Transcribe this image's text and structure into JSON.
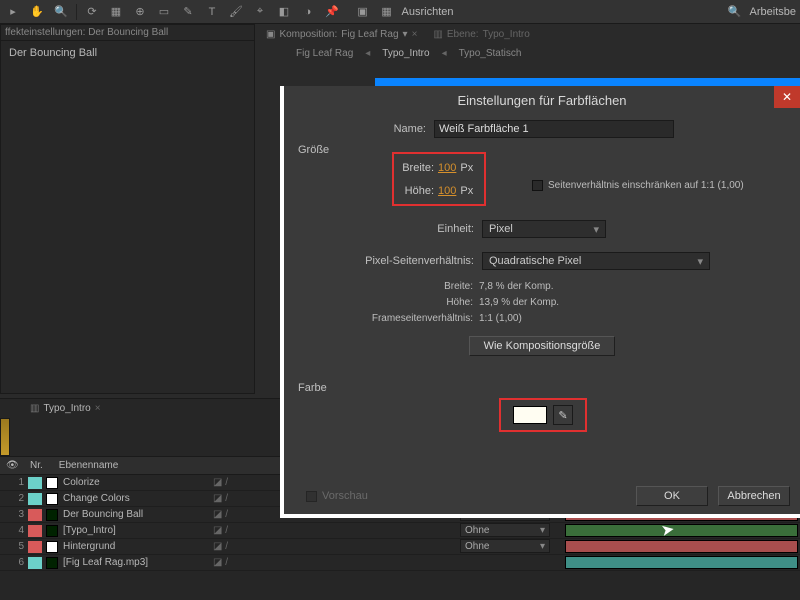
{
  "toolbar": {
    "align_label": "Ausrichten",
    "workspace_label": "Arbeitsbe"
  },
  "comp_tabs": {
    "tab1_prefix": "Komposition:",
    "tab1_name": "Fig Leaf Rag",
    "tab2_prefix": "Ebene:",
    "tab2_name": "Typo_Intro",
    "sub1": "Fig Leaf Rag",
    "sub2": "Typo_Intro",
    "sub3": "Typo_Statisch"
  },
  "left_panel": {
    "title": "ffekteinstellungen: Der Bouncing Ball",
    "label": "Der Bouncing Ball"
  },
  "dialog": {
    "title": "Einstellungen für Farbflächen",
    "name_label": "Name:",
    "name_value": "Weiß Farbfläche 1",
    "size_group": "Größe",
    "width_label": "Breite:",
    "width_value": "100",
    "width_unit": "Px",
    "height_label": "Höhe:",
    "height_value": "100",
    "height_unit": "Px",
    "lock_aspect_label": "Seitenverhältnis einschränken auf 1:1 (1,00)",
    "unit_label": "Einheit:",
    "unit_value": "Pixel",
    "par_label": "Pixel-Seitenverhältnis:",
    "par_value": "Quadratische Pixel",
    "info_width_k": "Breite:",
    "info_width_v": "7,8 % der Komp.",
    "info_height_k": "Höhe:",
    "info_height_v": "13,9 % der Komp.",
    "info_fsv_k": "Frameseitenverhältnis:",
    "info_fsv_v": "1:1 (1,00)",
    "make_comp_size": "Wie Kompositionsgröße",
    "color_group": "Farbe",
    "preview_label": "Vorschau",
    "ok": "OK",
    "cancel": "Abbrechen"
  },
  "timeline": {
    "tab": "Typo_Intro",
    "col_num": "Nr.",
    "col_name": "Ebenenname",
    "mode_none": "Ohne",
    "layers": [
      {
        "n": "1",
        "color": "#6cd1c9",
        "box": "#ffffff",
        "name": "Colorize"
      },
      {
        "n": "2",
        "color": "#6cd1c9",
        "box": "#ffffff",
        "name": "Change Colors"
      },
      {
        "n": "3",
        "color": "#d85a5a",
        "box": "",
        "name": "Der Bouncing Ball"
      },
      {
        "n": "4",
        "color": "#d85a5a",
        "box": "",
        "name": "[Typo_Intro]"
      },
      {
        "n": "5",
        "color": "#d85a5a",
        "box": "#ffffff",
        "name": "Hintergrund"
      },
      {
        "n": "6",
        "color": "#6cd1c9",
        "box": "",
        "name": "[Fig Leaf Rag.mp3]"
      }
    ]
  }
}
